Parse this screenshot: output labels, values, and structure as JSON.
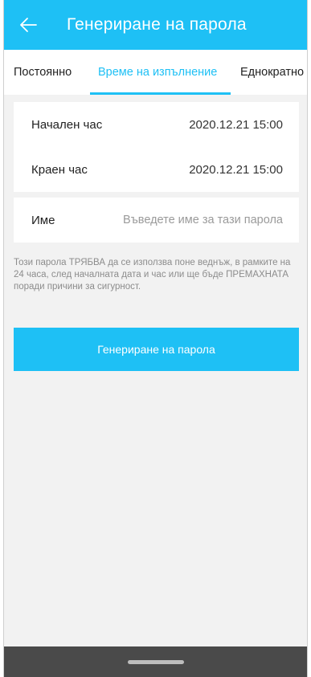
{
  "header": {
    "title": "Генериране на парола",
    "back_icon": "arrow-left-icon",
    "color": "#1ec0f5"
  },
  "tabs": [
    {
      "label": "Постоянно",
      "active": false
    },
    {
      "label": "Време на изпълнение",
      "active": true
    },
    {
      "label": "Еднократно",
      "active": false
    }
  ],
  "time_card": {
    "start_label": "Начален час",
    "start_value": "2020.12.21 15:00",
    "end_label": "Краен час",
    "end_value": "2020.12.21 15:00"
  },
  "name_card": {
    "label": "Име",
    "value": "",
    "placeholder": "Въведете име за тази парола"
  },
  "notice": "Този парола ТРЯБВА да се използва поне веднъж, в рамките на 24 часа, след началната дата и час или ще бъде ПРЕМАХНАТА поради причини за сигурност.",
  "generate_button": "Генериране на парола"
}
